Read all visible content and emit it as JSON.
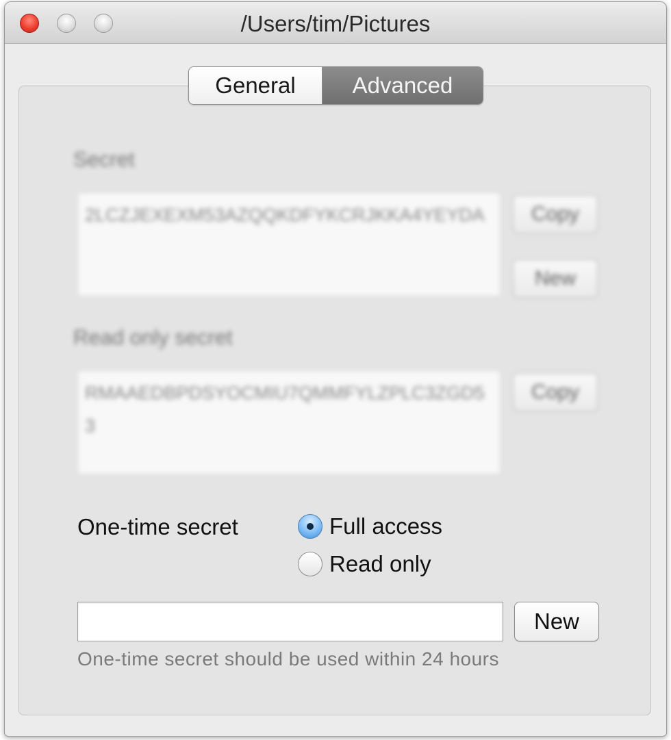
{
  "window": {
    "title": "/Users/tim/Pictures"
  },
  "tabs": [
    {
      "label": "General",
      "selected": false
    },
    {
      "label": "Advanced",
      "selected": true
    }
  ],
  "secret": {
    "label": "Secret",
    "value": "2LCZJEXEXM53AZQQKDFYKCRJKKA4YEYDA",
    "copy_label": "Copy",
    "new_label": "New"
  },
  "read_only_secret": {
    "label": "Read only secret",
    "value": "RMAAEDBPDSYOCMIU7QMMFYLZPLC3ZGD53",
    "copy_label": "Copy"
  },
  "one_time": {
    "label": "One-time secret",
    "options": [
      {
        "label": "Full access",
        "selected": true
      },
      {
        "label": "Read only",
        "selected": false
      }
    ],
    "input_value": "",
    "new_label": "New",
    "hint": "One-time secret should be used within 24 hours"
  },
  "colors": {
    "close_button": "#ef3f30",
    "selected_tab": "#7a7a7a",
    "radio_selected": "#3b8de0"
  }
}
